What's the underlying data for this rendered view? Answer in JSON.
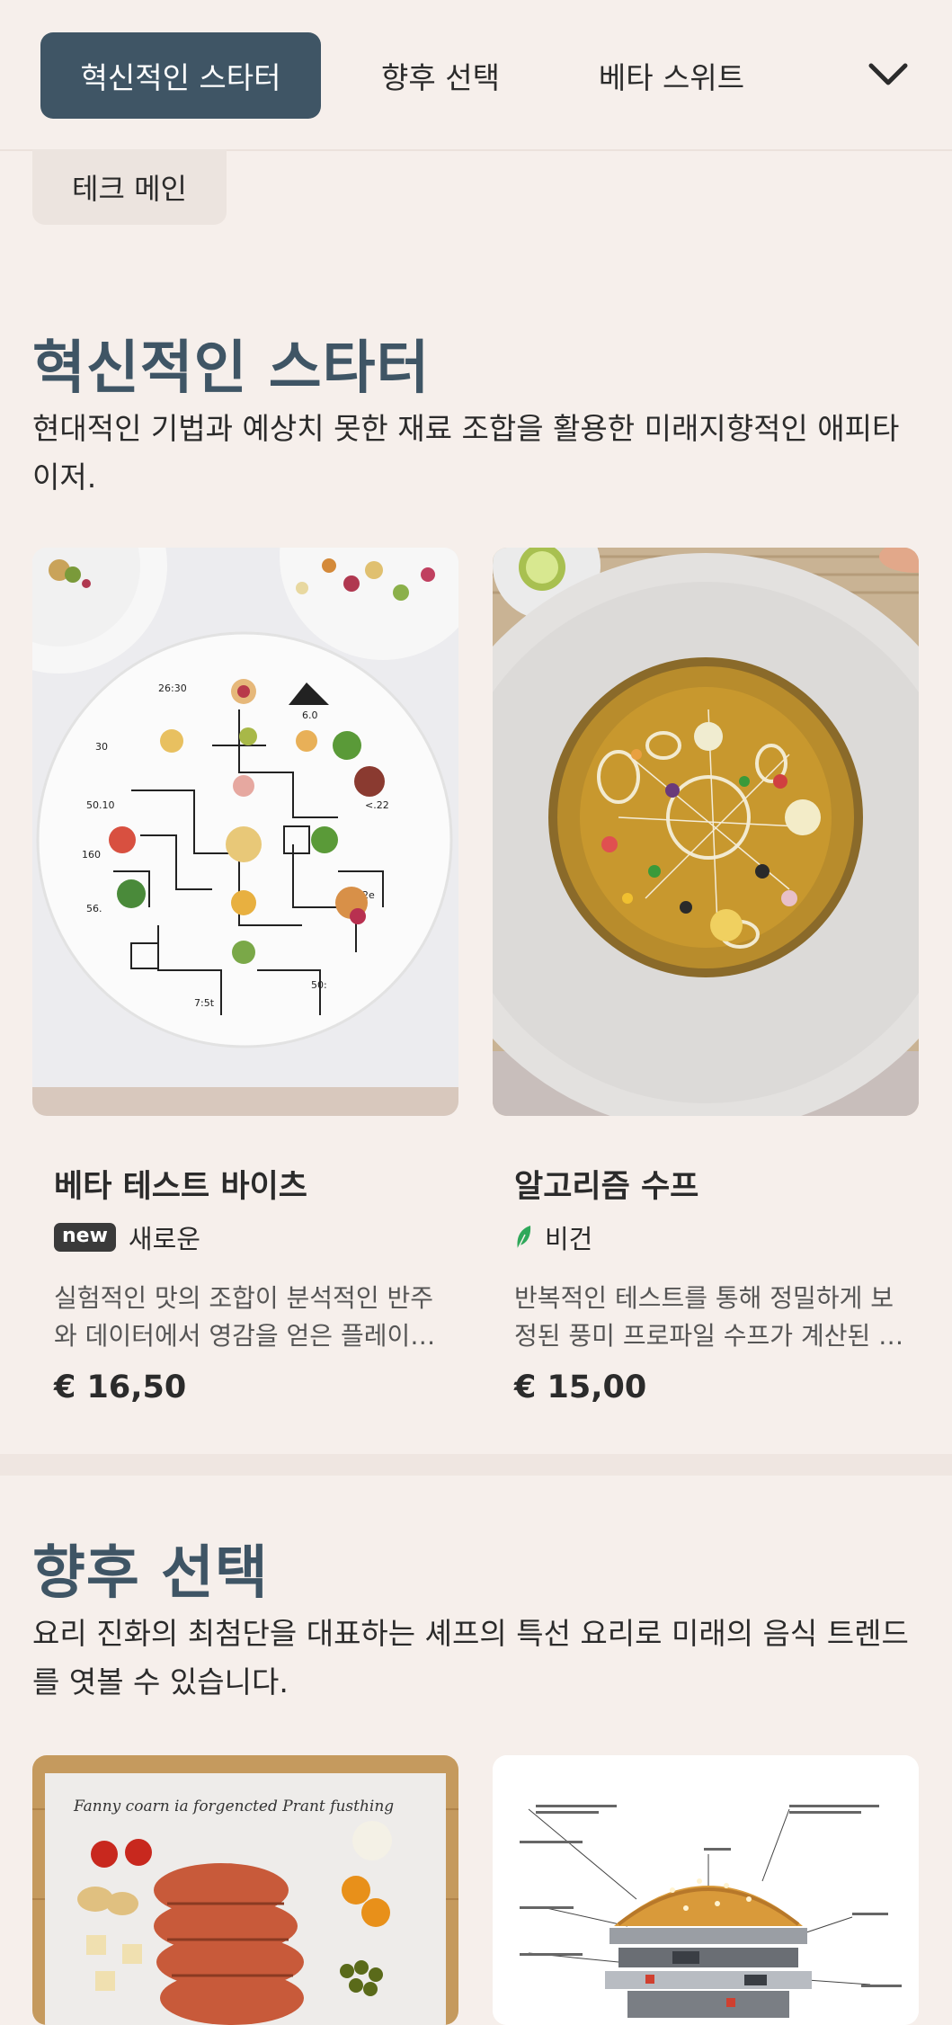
{
  "nav": {
    "tabs": [
      {
        "label": "혁신적인 스타터",
        "active": true
      },
      {
        "label": "향후 선택",
        "active": false
      },
      {
        "label": "베타 스위트",
        "active": false
      }
    ],
    "more_icon": "chevron-down-icon",
    "overflow_tab": "테크 메인"
  },
  "sections": [
    {
      "title": "혁신적인 스타터",
      "description": "현대적인 기법과 예상치 못한 재료 조합을 활용한 미래지향적인 애피타이저.",
      "items": [
        {
          "name": "베타 테스트 바이츠",
          "badge": "new",
          "tag": "새로운",
          "description": "실험적인 맛의 조합이 분석적인 반주와 데이터에서 영감을 얻은 플레이팅으로 제공됩니다.",
          "price": "€ 16,50",
          "image": "circuit-plate-appetizer-photo"
        },
        {
          "name": "알고리즘 수프",
          "tag_icon": "leaf-icon",
          "tag": "비건",
          "description": "반복적인 테스트를 통해 정밀하게 보정된 풍미 프로파일 수프가 계산된 토핑과 함께 제공됩니다.",
          "price": "€ 15,00",
          "image": "geometric-soup-bowl-photo"
        }
      ]
    },
    {
      "title": "향후 선택",
      "description": "요리 진화의 최첨단을 대표하는 셰프의 특선 요리로 미래의 음식 트렌드를 엿볼 수 있습니다.",
      "items": [
        {
          "image": "sliced-roast-platter-photo",
          "image_caption": "Fanny coarn ia forgencted Prant fusthing"
        },
        {
          "image": "exploded-burger-diagram-photo"
        }
      ]
    }
  ],
  "colors": {
    "background": "#f6efeb",
    "accent": "#3f5565",
    "vegan_green": "#2fa85a"
  }
}
